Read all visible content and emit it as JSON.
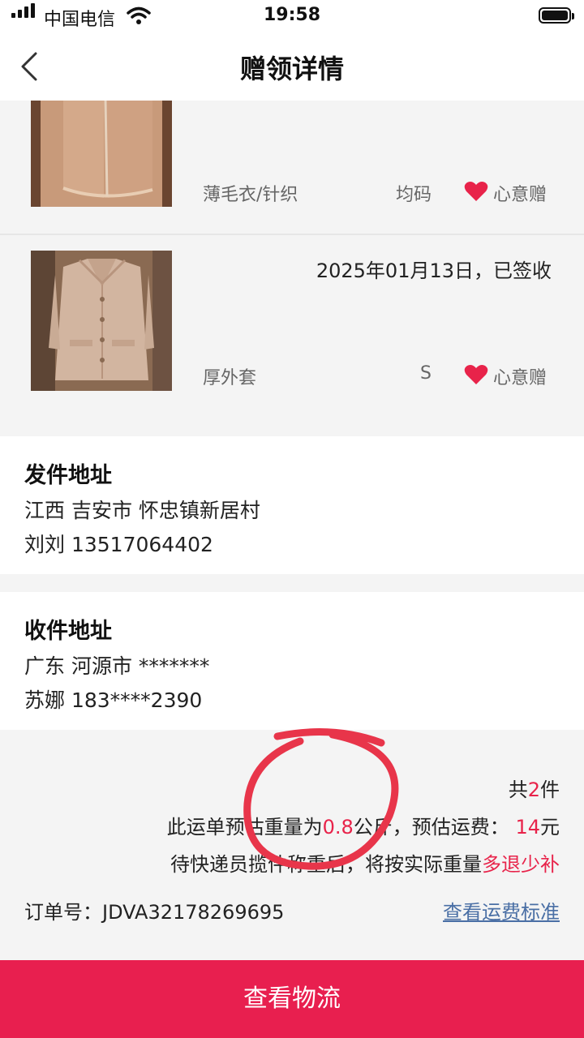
{
  "status_bar": {
    "carrier": "中国电信",
    "time": "19:58"
  },
  "nav": {
    "title": "赠领详情"
  },
  "items": [
    {
      "category": "薄毛衣/针织",
      "size": "均码",
      "tag": "心意赠",
      "status": ""
    },
    {
      "category": "厚外套",
      "size": "S",
      "tag": "心意赠",
      "status": "2025年01月13日，已签收"
    }
  ],
  "sender": {
    "title": "发件地址",
    "address": "江西 吉安市 怀忠镇新居村",
    "contact": "刘刘 13517064402"
  },
  "receiver": {
    "title": "收件地址",
    "address": "广东 河源市 *******",
    "contact": "苏娜 183****2390"
  },
  "summary": {
    "count_prefix": "共",
    "count": "2",
    "count_suffix": "件",
    "weight_prefix": "此运单预估重量为",
    "weight": "0.8",
    "weight_unit": "公斤，预估运费：",
    "fee": "14",
    "fee_unit": "元",
    "note_prefix": "待快递员揽件称重后，将按实际重量",
    "note_highlight": "多退少补",
    "order_label": "订单号：",
    "order_no": "JDVA32178269695",
    "fee_standard_link": "查看运费标准"
  },
  "bottom_button": "查看物流",
  "colors": {
    "accent": "#e8234a",
    "button": "#e81f4f",
    "link": "#4a6fa5",
    "annotation": "#e8354a"
  }
}
